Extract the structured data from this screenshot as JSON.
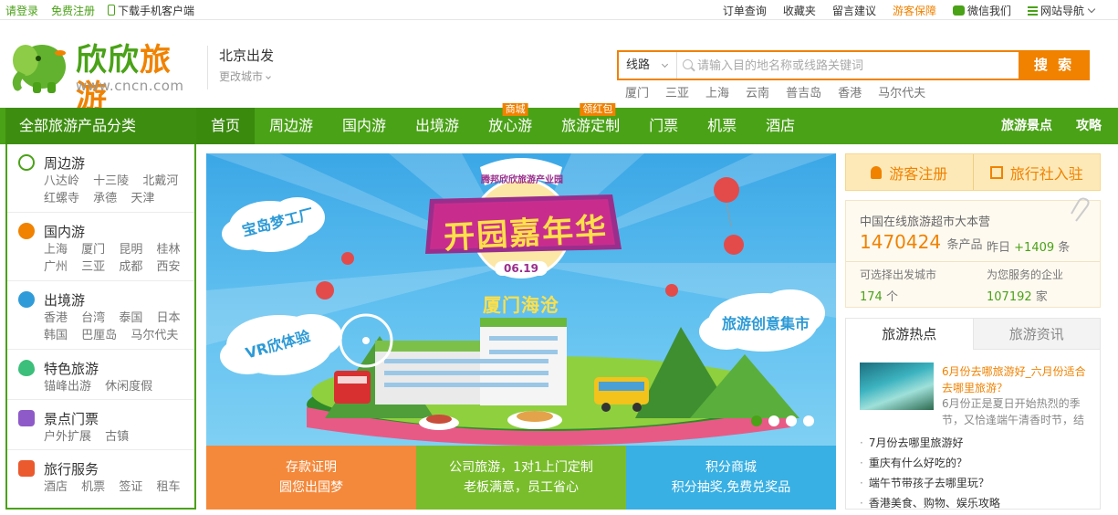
{
  "topbar": {
    "login": "请登录",
    "register": "免费注册",
    "app_download": "下载手机客户端",
    "orders": "订单查询",
    "favorites": "收藏夹",
    "feedback": "留言建议",
    "guarantee": "游客保障",
    "wechat": "微信我们",
    "sitemap": "网站导航"
  },
  "logo": {
    "title_a": "欣欣",
    "title_b": "旅游",
    "url": "www.cncn.com"
  },
  "city": {
    "current": "北京出发",
    "change": "更改城市"
  },
  "search": {
    "type": "线路",
    "placeholder": "请输入目的地名称或线路关键词",
    "button": "搜 索",
    "hotwords": [
      "厦门",
      "三亚",
      "上海",
      "云南",
      "普吉岛",
      "香港",
      "马尔代夫"
    ]
  },
  "nav": {
    "all_categories": "全部旅游产品分类",
    "items": [
      {
        "label": "首页",
        "tag": ""
      },
      {
        "label": "周边游",
        "tag": ""
      },
      {
        "label": "国内游",
        "tag": ""
      },
      {
        "label": "出境游",
        "tag": ""
      },
      {
        "label": "放心游",
        "tag": "商城"
      },
      {
        "label": "旅游定制",
        "tag": "领红包"
      },
      {
        "label": "门票",
        "tag": ""
      },
      {
        "label": "机票",
        "tag": ""
      },
      {
        "label": "酒店",
        "tag": ""
      }
    ],
    "right": [
      "旅游景点",
      "攻略"
    ]
  },
  "sidebar": [
    {
      "title": "周边游",
      "icon": "location-pin-icon",
      "color": "#4aa217",
      "links": [
        "八达岭",
        "十三陵",
        "北戴河",
        "红螺寺",
        "承德",
        "天津"
      ]
    },
    {
      "title": "国内游",
      "icon": "china-map-icon",
      "color": "#f08200",
      "links": [
        "上海",
        "厦门",
        "昆明",
        "桂林",
        "广州",
        "三亚",
        "成都",
        "西安"
      ]
    },
    {
      "title": "出境游",
      "icon": "globe-icon",
      "color": "#2f9bd8",
      "links": [
        "香港",
        "台湾",
        "泰国",
        "日本",
        "韩国",
        "巴厘岛",
        "马尔代夫"
      ]
    },
    {
      "title": "特色旅游",
      "icon": "balloon-icon",
      "color": "#3bbf7a",
      "links": [
        "锚峰出游",
        "休闲度假"
      ]
    },
    {
      "title": "景点门票",
      "icon": "ticket-icon",
      "color": "#8e5ac8",
      "links": [
        "户外扩展",
        "古镇"
      ]
    },
    {
      "title": "旅行服务",
      "icon": "suitcase-icon",
      "color": "#ea5a2e",
      "links": [
        "酒店",
        "机票",
        "签证",
        "租车"
      ]
    }
  ],
  "banner": {
    "park_name": "腾邦欣欣旅游产业园",
    "headline": "开园嘉年华",
    "date": "06.19",
    "location": "厦门海沧",
    "cloud_left_top": "宝岛梦工厂",
    "cloud_left_bottom": "VR欣体验",
    "cloud_right": "旅游创意集市",
    "slide_count": 4,
    "active_slide": 1
  },
  "promos": [
    {
      "line1": "存款证明",
      "line2": "圆您出国梦",
      "color": "#f4893b"
    },
    {
      "line1": "公司旅游，1对1上门定制",
      "line2": "老板满意，员工省心",
      "color": "#79bd2c"
    },
    {
      "line1": "积分商城",
      "line2": "积分抽奖,免费兑奖品",
      "color": "#39b0e3"
    }
  ],
  "right": {
    "register_tourist": "游客注册",
    "agency_join": "旅行社入驻",
    "stats_title": "中国在线旅游超市大本营",
    "products_count": "1470424",
    "products_unit": "条产品",
    "yesterday_label": "昨日",
    "yesterday_count": "+1409",
    "yesterday_unit": "条",
    "cities_label": "可选择出发城市",
    "cities_count": "174",
    "cities_unit": "个",
    "companies_label": "为您服务的企业",
    "companies_count": "107192",
    "companies_unit": "家",
    "tab_hot": "旅游热点",
    "tab_news": "旅游资讯",
    "featured_title": "6月份去哪旅游好_六月份适合去哪里旅游？",
    "featured_desc": "6月份正是夏日开始热烈的季节，又恰逢端午清香时节，结",
    "news": [
      "7月份去哪里旅游好",
      "重庆有什么好吃的？",
      "端午节带孩子去哪里玩？",
      "香港美食、购物、娱乐攻略"
    ]
  }
}
